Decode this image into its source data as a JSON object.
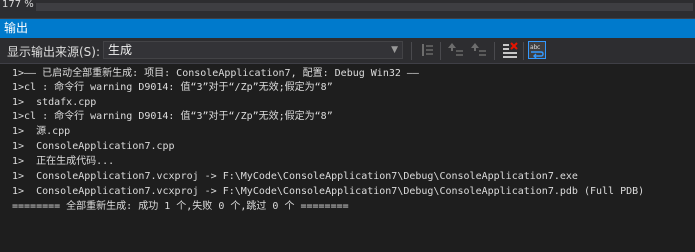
{
  "header": {
    "zoom": "177 %",
    "title": "输出"
  },
  "toolbar": {
    "source_label": "显示输出来源(S):",
    "source_value": "生成"
  },
  "output_lines": [
    "1>—— 已启动全部重新生成: 项目: ConsoleApplication7, 配置: Debug Win32 ——",
    "1>cl : 命令行 warning D9014: 值“3”对于“/Zp”无效;假定为“8”",
    "1>  stdafx.cpp",
    "1>cl : 命令行 warning D9014: 值“3”对于“/Zp”无效;假定为“8”",
    "1>  源.cpp",
    "1>  ConsoleApplication7.cpp",
    "1>  正在生成代码...",
    "1>  ConsoleApplication7.vcxproj -> F:\\MyCode\\ConsoleApplication7\\Debug\\ConsoleApplication7.exe",
    "1>  ConsoleApplication7.vcxproj -> F:\\MyCode\\ConsoleApplication7\\Debug\\ConsoleApplication7.pdb (Full PDB)",
    "======== 全部重新生成: 成功 1 个,失败 0 个,跳过 0 个 ========"
  ],
  "icons": {
    "find_message": "find-message-icon",
    "go_prev": "go-to-previous-message-icon",
    "go_next": "go-to-next-message-icon",
    "clear_all": "clear-all-icon",
    "word_wrap": "word-wrap-icon"
  },
  "colors": {
    "accent": "#007acc",
    "background": "#1e1e1e",
    "toolbar": "#2d2d30",
    "text": "#dcdcdc"
  }
}
